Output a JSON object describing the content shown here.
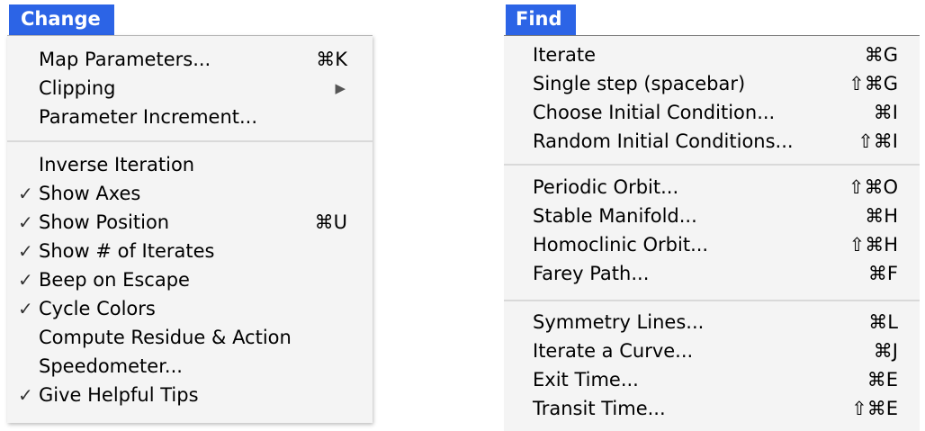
{
  "change_menu": {
    "title": "Change",
    "items": [
      {
        "label": "Map Parameters...",
        "shortcut": "⌘K"
      },
      {
        "label": "Clipping",
        "submenu_indicator": "▶"
      },
      {
        "label": "Parameter Increment..."
      },
      {
        "label": "Inverse Iteration"
      },
      {
        "label": "Show Axes",
        "checked": true,
        "check": "✓"
      },
      {
        "label": "Show Position",
        "checked": true,
        "check": "✓",
        "shortcut": "⌘U"
      },
      {
        "label": "Show # of Iterates",
        "checked": true,
        "check": "✓"
      },
      {
        "label": "Beep on Escape",
        "checked": true,
        "check": "✓"
      },
      {
        "label": "Cycle Colors",
        "checked": true,
        "check": "✓"
      },
      {
        "label": "Compute Residue & Action"
      },
      {
        "label": "Speedometer..."
      },
      {
        "label": "Give Helpful Tips",
        "checked": true,
        "check": "✓"
      }
    ]
  },
  "find_menu": {
    "title": "Find",
    "items": [
      {
        "label": "Iterate",
        "shortcut": "⌘G"
      },
      {
        "label": "Single step (spacebar)",
        "shortcut": "⇧⌘G"
      },
      {
        "label": "Choose Initial Condition...",
        "shortcut": "⌘I"
      },
      {
        "label": "Random Initial Conditions...",
        "shortcut": "⇧⌘I"
      },
      {
        "label": "Periodic Orbit...",
        "shortcut": "⇧⌘O"
      },
      {
        "label": "Stable Manifold...",
        "shortcut": "⌘H"
      },
      {
        "label": "Homoclinic Orbit...",
        "shortcut": "⇧⌘H"
      },
      {
        "label": "Farey Path...",
        "shortcut": "⌘F"
      },
      {
        "label": "Symmetry Lines...",
        "shortcut": "⌘L"
      },
      {
        "label": "Iterate a Curve...",
        "shortcut": "⌘J"
      },
      {
        "label": "Exit Time...",
        "shortcut": "⌘E"
      },
      {
        "label": "Transit Time...",
        "shortcut": "⇧⌘E"
      }
    ]
  },
  "colors": {
    "menu_title_bg": "#2c64e6",
    "menu_bg": "#f4f4f4",
    "separator": "#d9d9d9"
  }
}
